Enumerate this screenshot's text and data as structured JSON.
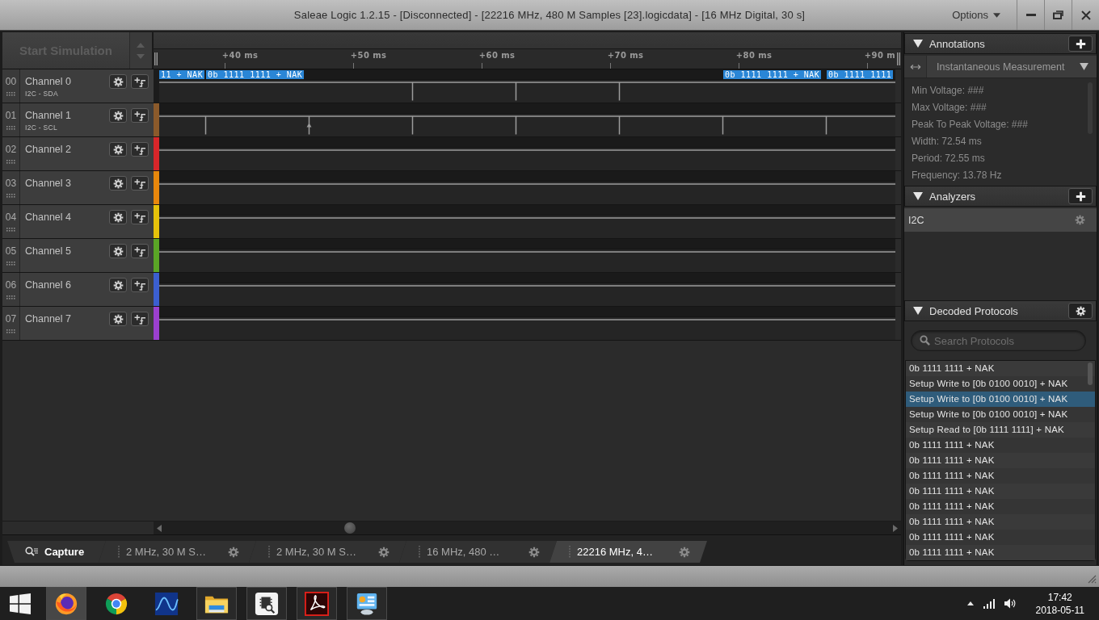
{
  "window": {
    "title": "Saleae Logic 1.2.15 - [Disconnected] - [22216 MHz, 480 M Samples [23].logicdata] - [16 MHz Digital, 30 s]",
    "menu": "Options"
  },
  "toolbar": {
    "simulation_button": "Start Simulation"
  },
  "timeline": {
    "ticks": [
      "+40 ms",
      "+50 ms",
      "+60 ms",
      "+70 ms",
      "+80 ms",
      "+90 m"
    ]
  },
  "channels": [
    {
      "number": "00",
      "name": "Channel 0",
      "signal": "I2C - SDA",
      "color": "#1c1c1c",
      "decodes": [
        "11 + NAK",
        "0b 1111 1111 + NAK",
        "0b 1111 1111 + NAK",
        "0b 1111 1111"
      ]
    },
    {
      "number": "01",
      "name": "Channel 1",
      "signal": "I2C - SCL",
      "color": "#8b5a2b"
    },
    {
      "number": "02",
      "name": "Channel 2",
      "color": "#d8262a"
    },
    {
      "number": "03",
      "name": "Channel 3",
      "color": "#e8870c"
    },
    {
      "number": "04",
      "name": "Channel 4",
      "color": "#e6c20a"
    },
    {
      "number": "05",
      "name": "Channel 5",
      "color": "#5aa526"
    },
    {
      "number": "06",
      "name": "Channel 6",
      "color": "#3b5fd0"
    },
    {
      "number": "07",
      "name": "Channel 7",
      "color": "#9b40cf"
    }
  ],
  "annotations": {
    "title": "Annotations",
    "measurement_mode": "Instantaneous Measurement",
    "measurements": [
      "Min Voltage: ###",
      "Max Voltage: ###",
      "Peak To Peak Voltage: ###",
      "Width: 72.54 ms",
      "Period: 72.55 ms",
      "Frequency: 13.78 Hz"
    ]
  },
  "analyzers": {
    "title": "Analyzers",
    "items": [
      {
        "name": "I2C",
        "selected": true
      }
    ]
  },
  "decoded_protocols": {
    "title": "Decoded Protocols",
    "search": {
      "placeholder": "Search Protocols"
    },
    "rows": [
      {
        "text": "0b 1111 1111 + NAK",
        "selected": false
      },
      {
        "text": "Setup Write to [0b 0100 0010] + NAK",
        "selected": false
      },
      {
        "text": "Setup Write to [0b 0100 0010] + NAK",
        "selected": true
      },
      {
        "text": "Setup Write to [0b 0100 0010] + NAK",
        "selected": false
      },
      {
        "text": "Setup Read to [0b 1111 1111] + NAK",
        "selected": false
      },
      {
        "text": "0b 1111 1111 + NAK",
        "selected": false
      },
      {
        "text": "0b 1111 1111 + NAK",
        "selected": false
      },
      {
        "text": "0b 1111 1111 + NAK",
        "selected": false
      },
      {
        "text": "0b 1111 1111 + NAK",
        "selected": false
      },
      {
        "text": "0b 1111 1111 + NAK",
        "selected": false
      },
      {
        "text": "0b 1111 1111 + NAK",
        "selected": false
      },
      {
        "text": "0b 1111 1111 + NAK",
        "selected": false
      },
      {
        "text": "0b 1111 1111 + NAK",
        "selected": false
      }
    ]
  },
  "session_tabs": [
    {
      "kind": "capture",
      "label": "Capture",
      "selected": false
    },
    {
      "kind": "session",
      "label": "2 MHz, 30 M S…",
      "selected": false
    },
    {
      "kind": "session",
      "label": "2 MHz, 30 M S…",
      "selected": false
    },
    {
      "kind": "session",
      "label": "16 MHz, 480 …",
      "selected": false
    },
    {
      "kind": "session",
      "label": "22216 MHz, 4…",
      "selected": true
    }
  ],
  "taskbar": {
    "apps": [
      {
        "kind": "globe",
        "running": true,
        "active": true
      },
      {
        "kind": "ring",
        "running": false,
        "active": false
      },
      {
        "kind": "wave",
        "running": false,
        "active": false
      },
      {
        "kind": "folder",
        "running": true,
        "active": false
      },
      {
        "kind": "chip",
        "running": true,
        "active": false
      },
      {
        "kind": "swirl",
        "running": true,
        "active": false
      },
      {
        "kind": "panel",
        "running": true,
        "active": false
      }
    ],
    "time": "17:42",
    "date": "2018-05-11"
  }
}
